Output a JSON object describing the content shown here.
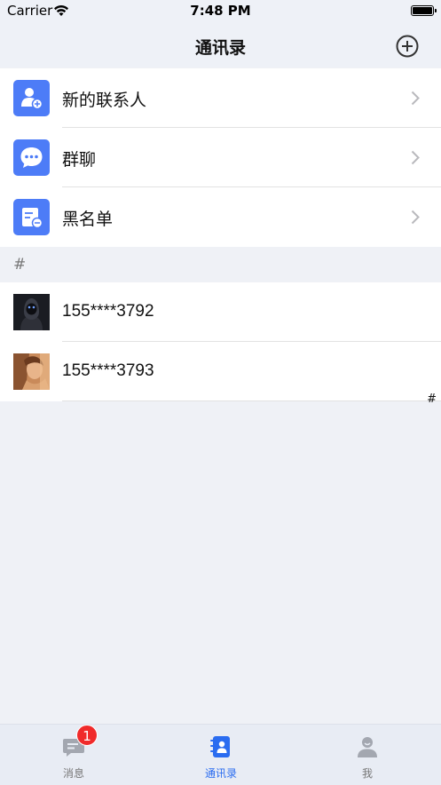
{
  "status_bar": {
    "carrier": "Carrier",
    "time": "7:48 PM"
  },
  "nav": {
    "title": "通讯录",
    "add_icon": "plus-circle-icon"
  },
  "functions": [
    {
      "label": "新的联系人",
      "icon": "new-contact-icon"
    },
    {
      "label": "群聊",
      "icon": "group-chat-icon"
    },
    {
      "label": "黑名单",
      "icon": "blacklist-icon"
    }
  ],
  "section": {
    "letter": "#"
  },
  "contacts": [
    {
      "name": "155****3792"
    },
    {
      "name": "155****3793"
    }
  ],
  "index_bar": {
    "letter": "#"
  },
  "tabs": [
    {
      "label": "消息",
      "icon": "message-icon",
      "badge": "1",
      "active": false
    },
    {
      "label": "通讯录",
      "icon": "contacts-icon",
      "active": true
    },
    {
      "label": "我",
      "icon": "profile-icon",
      "active": false
    }
  ],
  "colors": {
    "accent": "#2a6cf0",
    "icon_bg": "#4d7cf7",
    "badge": "#f02a2a",
    "background": "#eff1f6"
  }
}
